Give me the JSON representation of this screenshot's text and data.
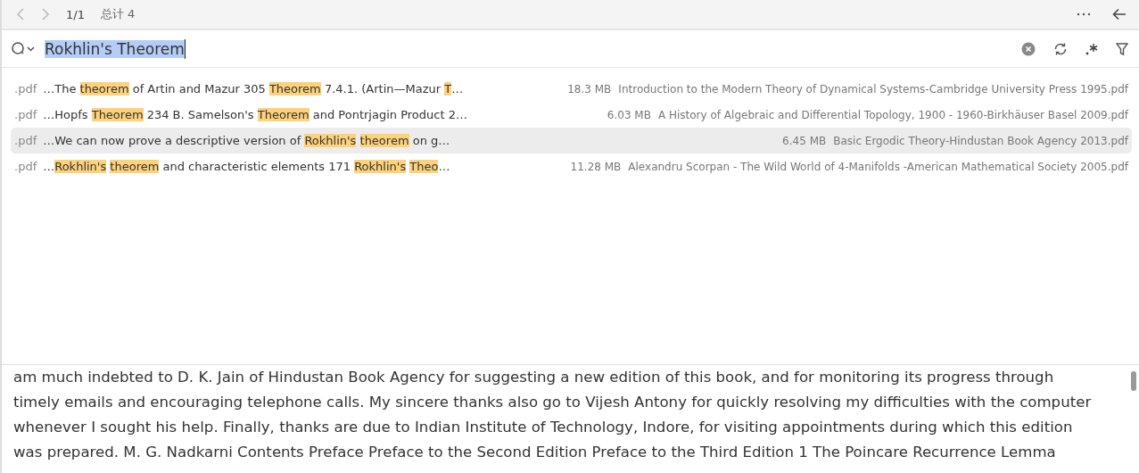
{
  "toolbar": {
    "page": "1/1",
    "total": "总计 4"
  },
  "search": {
    "value": "Rokhlin's Theorem",
    "selected_text": true
  },
  "results": [
    {
      "ext": ".pdf",
      "selected": false,
      "snippet": [
        {
          "text": "…The ",
          "highlight": false
        },
        {
          "text": "theorem",
          "highlight": true
        },
        {
          "text": " of Artin and Mazur 305 ",
          "highlight": false
        },
        {
          "text": "Theorem",
          "highlight": true
        },
        {
          "text": " 7.4.1. (Artin—Mazur ",
          "highlight": false
        },
        {
          "text": "T",
          "highlight": true
        },
        {
          "text": "…",
          "highlight": false
        }
      ],
      "size": "18.3 MB",
      "file": "Introduction to the Modern Theory of Dynamical Systems-Cambridge University Press 1995.pdf"
    },
    {
      "ext": ".pdf",
      "selected": false,
      "snippet": [
        {
          "text": "…Hopfs ",
          "highlight": false
        },
        {
          "text": "Theorem",
          "highlight": true
        },
        {
          "text": " 234 B. Samelson's ",
          "highlight": false
        },
        {
          "text": "Theorem",
          "highlight": true
        },
        {
          "text": " and Pontrjagin Product 2…",
          "highlight": false
        }
      ],
      "size": "6.03 MB",
      "file": "A History of Algebraic and Differential Topology, 1900 - 1960-Birkhäuser Basel 2009.pdf"
    },
    {
      "ext": ".pdf",
      "selected": true,
      "snippet": [
        {
          "text": "…We can now prove a descriptive version of ",
          "highlight": false
        },
        {
          "text": "Rokhlin's",
          "highlight": true,
          "space_after": true
        },
        {
          "text": "theorem",
          "highlight": true
        },
        {
          "text": " on g…",
          "highlight": false
        }
      ],
      "size": "6.45 MB",
      "file": "Basic Ergodic Theory-Hindustan Book Agency 2013.pdf"
    },
    {
      "ext": ".pdf",
      "selected": false,
      "snippet": [
        {
          "text": "…",
          "highlight": false
        },
        {
          "text": "Rokhlin's",
          "highlight": true,
          "space_after": true
        },
        {
          "text": "theorem",
          "highlight": true
        },
        {
          "text": " and characteristic elements 171 ",
          "highlight": false
        },
        {
          "text": "Rokhlin's",
          "highlight": true,
          "space_after": true
        },
        {
          "text": "Theo",
          "highlight": true
        },
        {
          "text": "…",
          "highlight": false
        }
      ],
      "size": "11.28 MB",
      "file": "Alexandru Scorpan - The Wild World of 4-Manifolds -American Mathematical Society 2005.pdf"
    }
  ],
  "preview": {
    "lines": [
      "am much indebted to D. K. Jain of Hindustan Book Agency for suggesting a new edition of this book, and for monitoring its progress through",
      "timely emails and encouraging telephone calls. My sincere thanks also go to Vijesh Antony for quickly resolving my difficulties with the computer",
      "whenever I sought his help. Finally, thanks are due to Indian Institute of Technology, Indore, for visiting appointments during which this edition",
      "was prepared. M. G. Nadkarni Contents Preface Preface to the Second Edition Preface to the Third Edition 1 The Poincare Recurrence Lemma"
    ]
  }
}
